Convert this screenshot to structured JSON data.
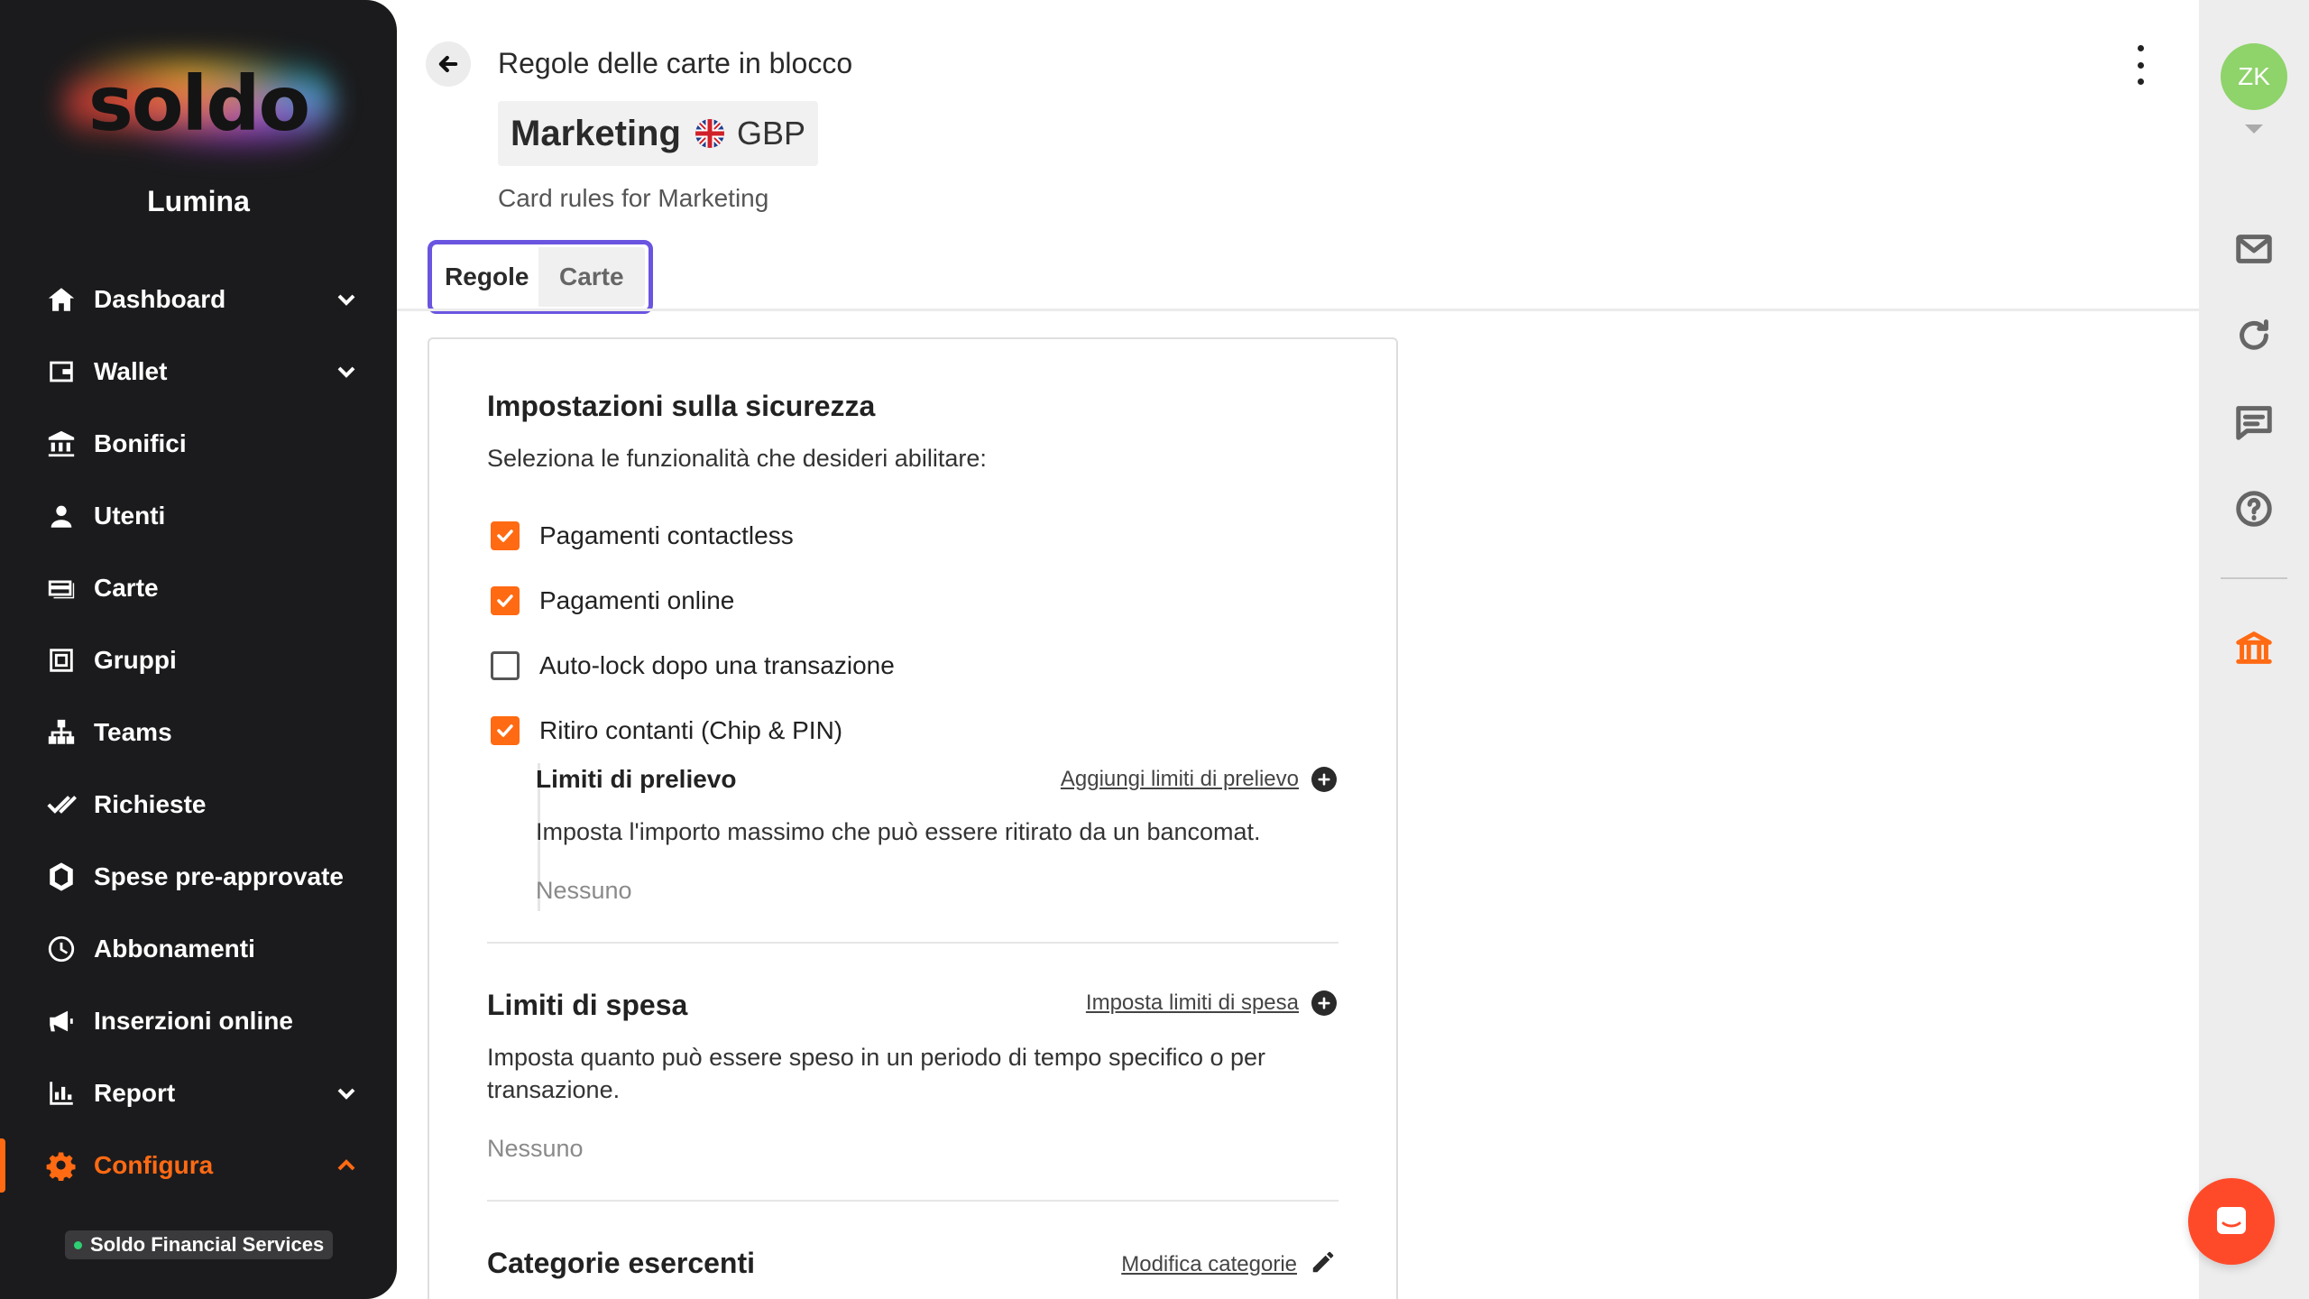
{
  "sidebar": {
    "logo_text": "soldo",
    "org_name": "Lumina",
    "items": [
      {
        "label": "Dashboard",
        "icon": "home-icon",
        "has_chevron": true,
        "chevron": "down"
      },
      {
        "label": "Wallet",
        "icon": "wallet-icon",
        "has_chevron": true,
        "chevron": "down"
      },
      {
        "label": "Bonifici",
        "icon": "bank-transfer-icon",
        "has_chevron": false
      },
      {
        "label": "Utenti",
        "icon": "user-icon",
        "has_chevron": false
      },
      {
        "label": "Carte",
        "icon": "card-icon",
        "has_chevron": false
      },
      {
        "label": "Gruppi",
        "icon": "groups-icon",
        "has_chevron": false
      },
      {
        "label": "Teams",
        "icon": "teams-icon",
        "has_chevron": false
      },
      {
        "label": "Richieste",
        "icon": "double-check-icon",
        "has_chevron": false
      },
      {
        "label": "Spese pre-approvate",
        "icon": "shield-icon",
        "has_chevron": false
      },
      {
        "label": "Abbonamenti",
        "icon": "clock-icon",
        "has_chevron": false
      },
      {
        "label": "Inserzioni online",
        "icon": "megaphone-icon",
        "has_chevron": false
      },
      {
        "label": "Report",
        "icon": "chart-icon",
        "has_chevron": true,
        "chevron": "down"
      },
      {
        "label": "Configura",
        "icon": "gear-icon",
        "has_chevron": true,
        "chevron": "up",
        "active": true
      }
    ],
    "footer_badge": "Soldo Financial Services"
  },
  "header": {
    "title": "Regole delle carte in blocco",
    "entity_name": "Marketing",
    "currency": "GBP",
    "subtitle": "Card rules for Marketing"
  },
  "tabs": [
    {
      "label": "Regole",
      "active": true
    },
    {
      "label": "Carte",
      "active": false
    }
  ],
  "security": {
    "title": "Impostazioni sulla sicurezza",
    "description": "Seleziona le funzionalità che desideri abilitare:",
    "options": [
      {
        "label": "Pagamenti contactless",
        "checked": true
      },
      {
        "label": "Pagamenti online",
        "checked": true
      },
      {
        "label": "Auto-lock dopo una transazione",
        "checked": false
      },
      {
        "label": "Ritiro contanti (Chip & PIN)",
        "checked": true
      }
    ],
    "withdrawal": {
      "title": "Limiti di prelievo",
      "action": "Aggiungi limiti di prelievo",
      "description": "Imposta l'importo massimo che può essere ritirato da un bancomat.",
      "value": "Nessuno"
    }
  },
  "spend_limits": {
    "title": "Limiti di spesa",
    "action": "Imposta limiti di spesa",
    "description": "Imposta quanto può essere speso in un periodo di tempo specifico o per transazione.",
    "value": "Nessuno"
  },
  "merchant_categories": {
    "title": "Categorie esercenti",
    "action": "Modifica categorie"
  },
  "rail": {
    "avatar_initials": "ZK",
    "icons": [
      "mail-icon",
      "refresh-icon",
      "chat-icon",
      "help-icon",
      "bank-icon"
    ]
  },
  "colors": {
    "accent": "#ff6a13",
    "tab_outline": "#6a55e0",
    "sidebar_bg": "#1b1b1d",
    "avatar_bg": "#8fd36b",
    "chat_fab": "#ff4a2a"
  }
}
